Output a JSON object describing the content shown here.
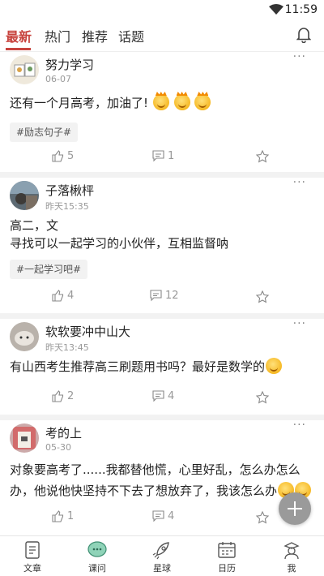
{
  "status": {
    "time": "11:59"
  },
  "tabs": [
    {
      "label": "最新",
      "active": true
    },
    {
      "label": "热门",
      "active": false
    },
    {
      "label": "推荐",
      "active": false
    },
    {
      "label": "话题",
      "active": false
    }
  ],
  "posts": [
    {
      "username": "努力学习",
      "time": "06-07",
      "text": "还有一个月高考，加油了!",
      "tag": "#励志句子#",
      "likes": "5",
      "comments": "1"
    },
    {
      "username": "子落楸枰",
      "time": "昨天15:35",
      "text_line1": "高二，文",
      "text_line2": "寻找可以一起学习的小伙伴，互相监督呐",
      "tag": "#一起学习吧#",
      "likes": "4",
      "comments": "12"
    },
    {
      "username": "软软要冲中山大",
      "time": "昨天13:45",
      "text": "有山西考生推荐高三刷题用书吗？最好是数学的",
      "likes": "2",
      "comments": "4"
    },
    {
      "username": "考的上",
      "time": "05-30",
      "text_line1": "对象要高考了......我都替他慌，心里好乱，怎么办怎么",
      "text_line2": "办，他说他快坚持不下去了想放弃了，我该怎么办",
      "likes": "1",
      "comments": "4"
    }
  ],
  "bottom_nav": [
    {
      "label": "文章",
      "icon": "article-icon"
    },
    {
      "label": "课问",
      "icon": "chat-bubble-icon"
    },
    {
      "label": "星球",
      "icon": "rocket-icon"
    },
    {
      "label": "日历",
      "icon": "calendar-icon"
    },
    {
      "label": "我",
      "icon": "profile-icon"
    }
  ],
  "colors": {
    "accent": "#c8443f",
    "fab": "#9a9a9a",
    "separator": "#f2f2f2"
  }
}
